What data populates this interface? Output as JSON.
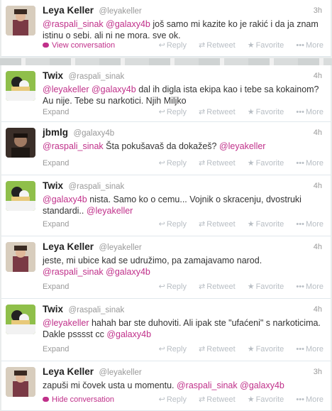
{
  "tweets": [
    {
      "fullname": "Leya Keller",
      "username": "@leyakeller",
      "time": "3h",
      "segments": [
        {
          "t": "@raspali_sinak",
          "m": true
        },
        {
          "t": " ",
          "m": false
        },
        {
          "t": "@galaxy4b",
          "m": true
        },
        {
          "t": " još samo mi kazite ko je rakić i da ja znam istinu o sebi. ali ni ne mora. sve ok.",
          "m": false
        }
      ],
      "footer_link": "View conversation",
      "footer_pink": true
    },
    {
      "fullname": "Twix",
      "username": "@raspali_sinak",
      "time": "4h",
      "segments": [
        {
          "t": "@leyakeller",
          "m": true
        },
        {
          "t": " ",
          "m": false
        },
        {
          "t": "@galaxy4b",
          "m": true
        },
        {
          "t": " dal ih digla ista ekipa kao i tebe sa kokainom? Au nije. Tebe su narkotici. Njih Miljko",
          "m": false
        }
      ],
      "footer_link": "Expand",
      "footer_pink": false
    },
    {
      "fullname": "jbmlg",
      "username": "@galaxy4b",
      "time": "4h",
      "segments": [
        {
          "t": "@raspali_sinak",
          "m": true
        },
        {
          "t": " Šta pokušavaš da dokažeš? ",
          "m": false
        },
        {
          "t": "@leyakeller",
          "m": true
        }
      ],
      "footer_link": "Expand",
      "footer_pink": false
    },
    {
      "fullname": "Twix",
      "username": "@raspali_sinak",
      "time": "4h",
      "segments": [
        {
          "t": "@galaxy4b",
          "m": true
        },
        {
          "t": " nista. Samo ko o cemu... Vojnik o skracenju, dvostruki standardi.. ",
          "m": false
        },
        {
          "t": "@leyakeller",
          "m": true
        }
      ],
      "footer_link": "Expand",
      "footer_pink": false
    },
    {
      "fullname": "Leya Keller",
      "username": "@leyakeller",
      "time": "4h",
      "segments": [
        {
          "t": "jeste, mi ubice kad se udružimo, pa zamajavamo narod. ",
          "m": false
        },
        {
          "t": "@raspali_sinak",
          "m": true
        },
        {
          "t": " ",
          "m": false
        },
        {
          "t": "@galaxy4b",
          "m": true
        }
      ],
      "footer_link": "Expand",
      "footer_pink": false
    },
    {
      "fullname": "Twix",
      "username": "@raspali_sinak",
      "time": "4h",
      "segments": [
        {
          "t": "@leyakeller",
          "m": true
        },
        {
          "t": " hahah bar ste duhoviti. Ali ipak ste \"ufaćeni\" s narkoticima. Dakle psssst cc ",
          "m": false
        },
        {
          "t": "@galaxy4b",
          "m": true
        }
      ],
      "footer_link": "Expand",
      "footer_pink": false
    },
    {
      "fullname": "Leya Keller",
      "username": "@leyakeller",
      "time": "3h",
      "segments": [
        {
          "t": "zapuši mi čovek usta u momentu. ",
          "m": false
        },
        {
          "t": "@raspali_sinak",
          "m": true
        },
        {
          "t": " ",
          "m": false
        },
        {
          "t": "@galaxy4b",
          "m": true
        }
      ],
      "footer_link": "Hide conversation",
      "footer_pink": true
    }
  ],
  "actions": {
    "reply": "Reply",
    "retweet": "Retweet",
    "favorite": "Favorite",
    "more": "More",
    "reply_icon": "reply-arrow-icon",
    "retweet_icon": "retweet-icon",
    "favorite_icon": "star-icon",
    "more_icon": "dots-icon"
  },
  "colors": {
    "mention": "#c0308a",
    "muted": "#999999"
  }
}
